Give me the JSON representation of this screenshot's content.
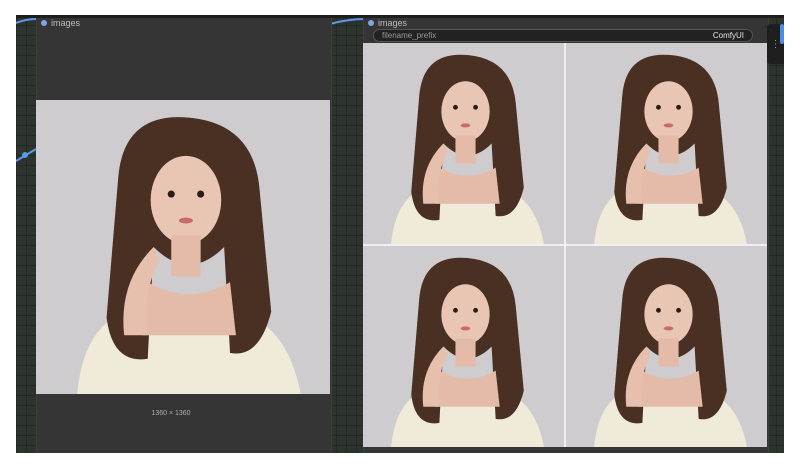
{
  "nodes": {
    "left": {
      "title": "images",
      "image_size_label": "1360 × 1360"
    },
    "right": {
      "title": "images",
      "widget": {
        "label": "filename_prefix",
        "value": "ComfyUI"
      },
      "image_count": 4
    }
  },
  "colors": {
    "canvas": "#2d342e",
    "node_body": "#353535",
    "link": "#5b9ae8",
    "hair": "#4a3023",
    "skin": "#e9c6b4",
    "sweater": "#f0ead8",
    "backdrop": "#cfccd0"
  },
  "icons": {
    "slot": "circle-dot",
    "side_handle": "grip-dots"
  },
  "image_subject": "portrait of a young woman with long brown hair, hand raised to her chin, wearing a cream knit top"
}
